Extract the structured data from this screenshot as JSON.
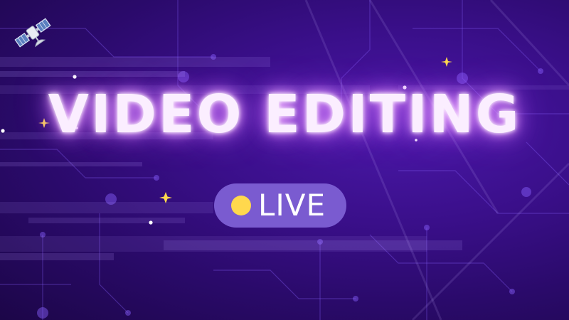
{
  "title": "VIDEO EDITING",
  "badge": {
    "label": "LIVE"
  },
  "icons": {
    "corner": "satellite-icon",
    "badge_dot": "status-dot-icon",
    "sparkle": "sparkle-icon"
  },
  "colors": {
    "background_deep": "#1c0648",
    "background_mid": "#3a0f8a",
    "title_glow": "#d77cff",
    "badge_fill": "#7a5bd0",
    "badge_dot": "#ffd84d",
    "sparkle": "#ffd84d"
  }
}
